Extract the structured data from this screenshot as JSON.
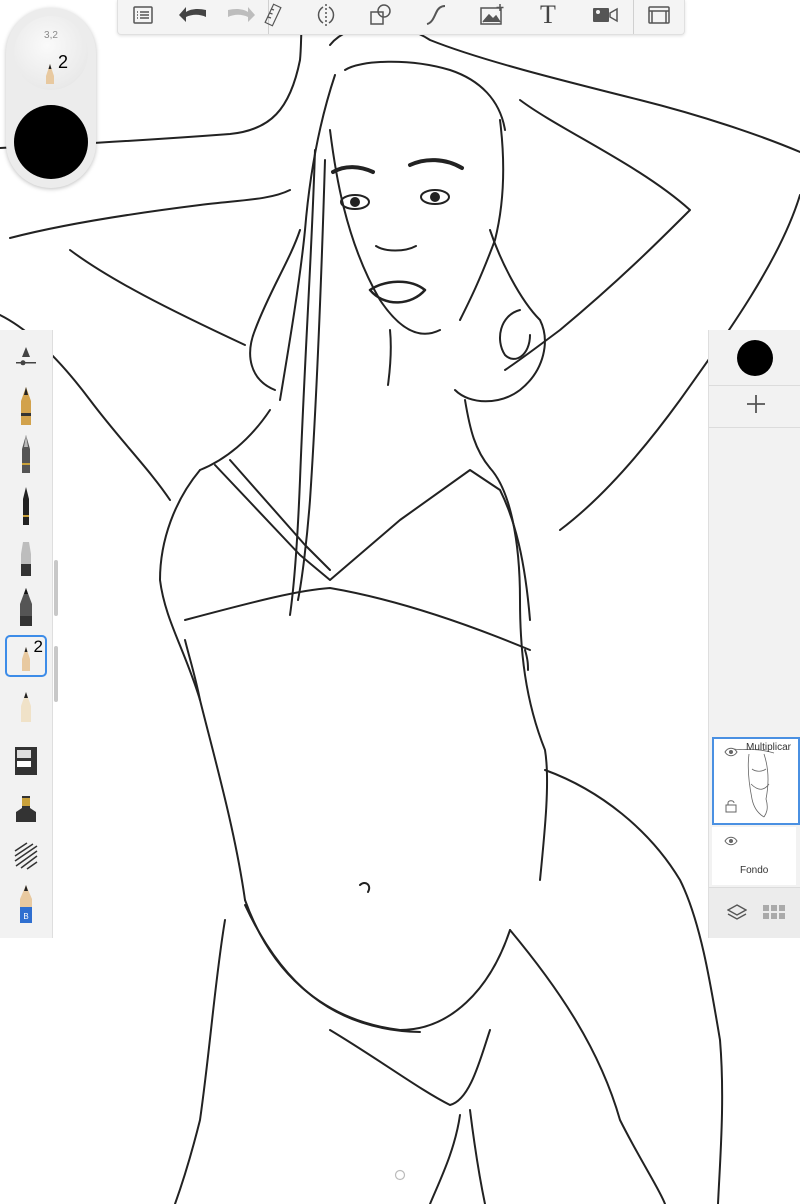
{
  "app": {
    "toolbar": {
      "items": [
        {
          "name": "list-menu-icon"
        },
        {
          "name": "undo-icon"
        },
        {
          "name": "redo-icon"
        },
        {
          "name": "ruler-icon"
        },
        {
          "name": "symmetry-icon"
        },
        {
          "name": "shapes-icon"
        },
        {
          "name": "curve-icon"
        },
        {
          "name": "add-image-icon"
        },
        {
          "name": "text-tool-icon",
          "glyph": "T"
        },
        {
          "name": "record-video-icon"
        },
        {
          "name": "fullscreen-icon"
        }
      ]
    },
    "puck": {
      "opacity_text": "3,2",
      "brush_number": "2",
      "color": "#000000"
    },
    "brush_palette": {
      "selected_brush_number": "2",
      "brushes": [
        "brush-settings-icon",
        "pencil-brush-icon",
        "technical-pen-icon",
        "fineliner-icon",
        "airbrush-icon",
        "dark-pencil-icon",
        "selected-pencil-icon",
        "light-pencil-icon",
        "marker-icon",
        "ink-brush-icon",
        "hatching-brush-icon",
        "blending-pencil-icon"
      ]
    },
    "layers": {
      "current_color": "#000000",
      "items": [
        {
          "name": "Multiplicar",
          "visible": true,
          "active": true
        },
        {
          "name": "Fondo",
          "visible": true,
          "active": false
        }
      ],
      "accent": "#4a90e2"
    }
  }
}
